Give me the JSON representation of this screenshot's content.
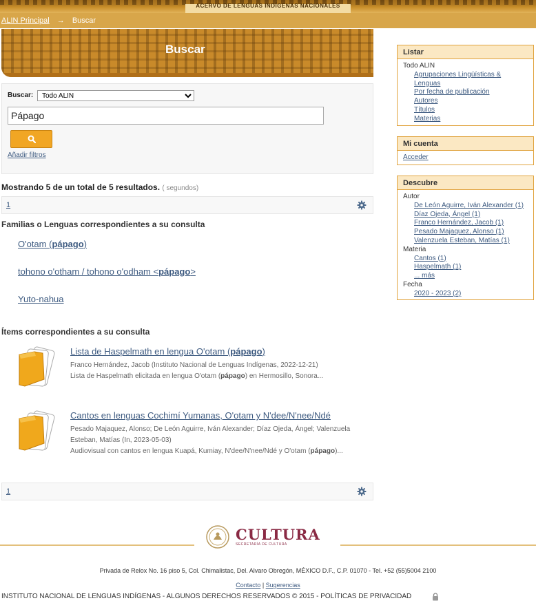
{
  "site": {
    "banner_title": "ACERVO DE LENGUAS INDÍGENAS NACIONALES"
  },
  "breadcrumb": {
    "home": "ALIN Principal",
    "arrow": "→",
    "current": "Buscar"
  },
  "search": {
    "heading": "Buscar",
    "scope_label": "Buscar:",
    "scope_value": "Todo ALIN",
    "query": "Pápago",
    "add_filters": "Añadir filtros"
  },
  "results": {
    "summary": "Mostrando 5 de un total de 5 resultados.",
    "seconds": "( segundos)",
    "page": "1"
  },
  "languages": {
    "title": "Familias o Lenguas correspondientes a su consulta",
    "items": [
      {
        "pre": "O'otam (",
        "bold": "pápago",
        "post": ")"
      },
      {
        "pre": "tohono o'otham / tohono o'odham <",
        "bold": "pápago",
        "post": ">"
      },
      {
        "pre": "Yuto-nahua",
        "bold": "",
        "post": ""
      }
    ]
  },
  "items": {
    "title": "Ítems correspondientes a su consulta",
    "list": [
      {
        "title_pre": "Lista de Haspelmath en lengua O'otam (",
        "title_bold": "pápago",
        "title_post": ")",
        "authors": "Franco Hernández, Jacob (Instituto Nacional de Lenguas Indígenas, 2022-12-21)",
        "desc_pre": "Lista de Haspelmath elicitada en lengua O'otam (",
        "desc_bold": "pápago",
        "desc_post": ") en Hermosillo, Sonora..."
      },
      {
        "title_pre": "Cantos en lenguas Cochimí Yumanas, O'otam y N'dee/N'nee/Ndé",
        "title_bold": "",
        "title_post": "",
        "authors": "Pesado Majaquez, Alonso; De León Aguirre, Iván Alexander; Díaz Ojeda, Ángel; Valenzuela Esteban, Matías (In, 2023-05-03)",
        "desc_pre": "Audiovisual con cantos en lengua Kuapá, Kumiay, N'dee/N'nee/Ndé y O'otam (",
        "desc_bold": "pápago",
        "desc_post": ")..."
      }
    ]
  },
  "sidebar": {
    "listar": {
      "title": "Listar",
      "root": "Todo ALIN",
      "links": [
        "Agrupaciones Lingüísticas &",
        "Lenguas",
        "Por fecha de publicación",
        "Autores",
        "Títulos",
        "Materias"
      ]
    },
    "cuenta": {
      "title": "Mi cuenta",
      "login": "Acceder"
    },
    "descubre": {
      "title": "Descubre",
      "autor_label": "Autor",
      "autores": [
        "De León Aguirre, Iván Alexander (1)",
        "Díaz Ojeda, Ángel (1)",
        "Franco Hernández, Jacob (1)",
        "Pesado Majaquez, Alonso (1)",
        "Valenzuela Esteban, Matías (1)"
      ],
      "materia_label": "Materia",
      "materias": [
        "Cantos (1)",
        "Haspelmath (1)",
        "... más"
      ],
      "fecha_label": "Fecha",
      "fechas": [
        "2020 - 2023 (2)"
      ]
    }
  },
  "footer": {
    "brand": "CULTURA",
    "brand_sub": "SECRETARÍA DE CULTURA",
    "address": "Privada de Relox No. 16 piso 5, Col. Chimalistac, Del. Alvaro Obregón, MÉXICO D.F., C.P. 01070 - Tel. +52 (55)5004 2100",
    "contact": "Contacto",
    "separator": "|",
    "suggestions": "Sugerencias",
    "legal": "INSTITUTO NACIONAL DE LENGUAS INDÍGENAS - ALGUNOS DERECHOS RESERVADOS © 2015 - POLÍTICAS DE PRIVACIDAD"
  },
  "colors": {
    "accent": "#f1a624",
    "link": "#3d5a80",
    "panel_border": "#e0a23c",
    "brand": "#8a2a44"
  },
  "icons": {
    "search": "search-icon",
    "settings": "gear-icon",
    "document": "document-stack-icon",
    "lock": "lock-icon"
  }
}
